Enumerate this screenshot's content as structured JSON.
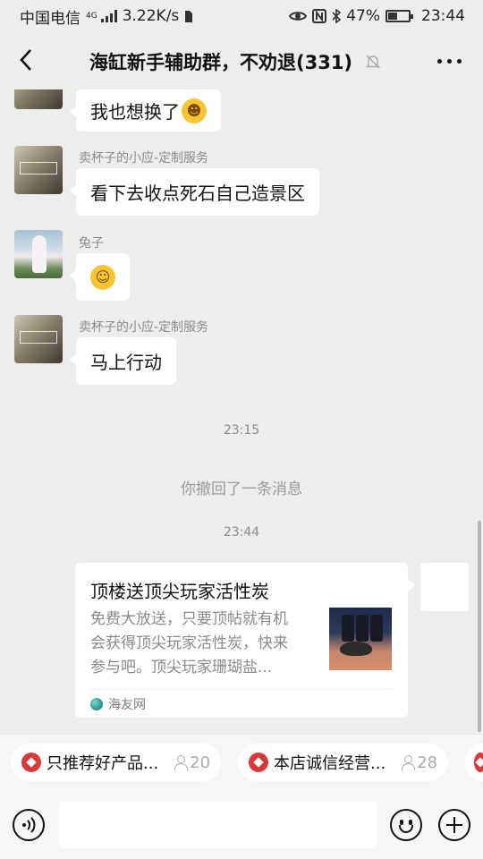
{
  "status_bar": {
    "carrier": "中国电信",
    "network_badge": "4G",
    "net_speed": "3.22K/s",
    "battery_percent": "47%",
    "battery_level": 0.47,
    "time": "23:44",
    "icons": [
      "signal-icon",
      "sim-icon",
      "eye-icon",
      "nfc-icon",
      "bluetooth-icon",
      "battery-icon"
    ]
  },
  "header": {
    "title": "海缸新手辅助群，不劝退(331)",
    "icons": [
      "back-arrow-icon",
      "mute-bell-icon",
      "more-dots-icon"
    ]
  },
  "messages": [
    {
      "sender": "",
      "text": "我也想换了",
      "emoji": "thinking-face"
    },
    {
      "sender": "卖杯子的小应-定制服务",
      "text": "看下去收点死石自己造景区"
    },
    {
      "sender": "兔子",
      "emoji": "smiling-face"
    },
    {
      "sender": "卖杯子的小应-定制服务",
      "text": "马上行动"
    }
  ],
  "timestamps": [
    "23:15",
    "23:44"
  ],
  "system_message": "你撤回了一条消息",
  "link_card": {
    "title": "顶楼送顶尖玩家活性炭",
    "desc_lines": [
      "免费大放送，只要顶帖就有机",
      "会获得顶尖玩家活性炭，快来",
      "参与吧。顶尖玩家珊瑚盐..."
    ],
    "source": "海友网"
  },
  "chips": [
    {
      "label": "只推荐好产品...",
      "count": "20"
    },
    {
      "label": "本店诚信经营...",
      "count": "28"
    }
  ],
  "input": {
    "placeholder": ""
  }
}
